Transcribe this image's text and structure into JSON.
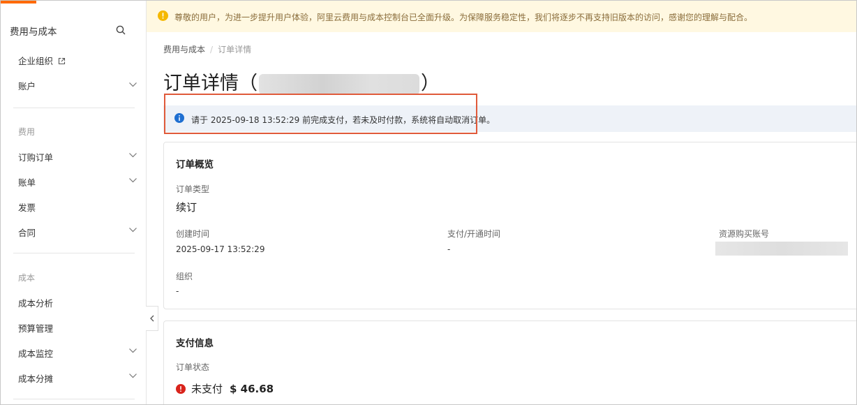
{
  "sidebar": {
    "title": "费用与成本",
    "items": [
      {
        "label": "企业组织",
        "external": true
      },
      {
        "label": "账户",
        "chevron": true
      }
    ],
    "group_fee": "费用",
    "fee_items": [
      {
        "label": "订购订单",
        "chevron": true
      },
      {
        "label": "账单",
        "chevron": true
      },
      {
        "label": "发票",
        "chevron": false
      },
      {
        "label": "合同",
        "chevron": true
      }
    ],
    "group_cost": "成本",
    "cost_items": [
      {
        "label": "成本分析",
        "chevron": false
      },
      {
        "label": "预算管理",
        "chevron": false
      },
      {
        "label": "成本监控",
        "chevron": true
      },
      {
        "label": "成本分摊",
        "chevron": true
      }
    ]
  },
  "banner": {
    "text": "尊敬的用户，为进一步提升用户体验，阿里云费用与成本控制台已全面升级。为保障服务稳定性，我们将逐步不再支持旧版本的访问，感谢您的理解与配合。"
  },
  "breadcrumb": {
    "root": "费用与成本",
    "current": "订单详情"
  },
  "page": {
    "title": "订单详情",
    "paren_open": "（",
    "paren_close": "）"
  },
  "notice": {
    "text": "请于 2025-09-18 13:52:29 前完成支付，若未及时付款，系统将自动取消订单。"
  },
  "overview": {
    "title": "订单概览",
    "order_type_label": "订单类型",
    "order_type_value": "续订",
    "created_label": "创建时间",
    "created_value": "2025-09-17 13:52:29",
    "paid_label": "支付/开通时间",
    "paid_value": "-",
    "account_label": "资源购买账号",
    "org_label": "组织",
    "org_value": "-"
  },
  "payment": {
    "title": "支付信息",
    "status_label": "订单状态",
    "status_value": "未支付",
    "amount": "$ 46.68"
  },
  "colors": {
    "accent": "#ff6a00",
    "info": "#1f6fd1",
    "error": "#d9241c",
    "highlight_border": "#e05a3a"
  }
}
